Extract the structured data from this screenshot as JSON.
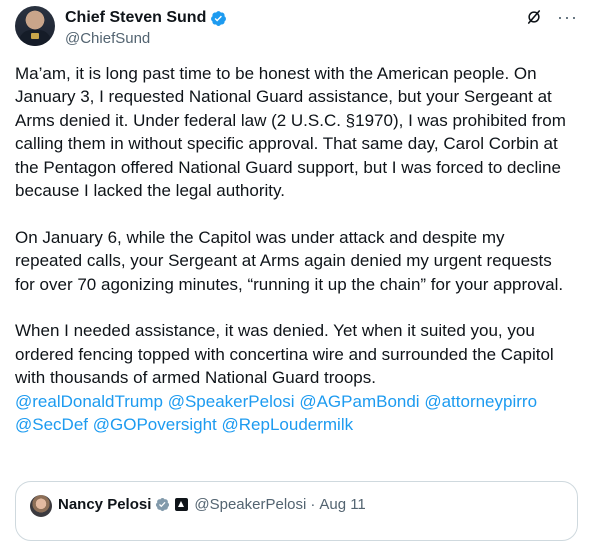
{
  "author": {
    "display_name": "Chief Steven Sund",
    "handle": "@ChiefSund"
  },
  "post": {
    "paragraphs": [
      "Ma’am, it is long past time to be honest with the American people. On January 3, I requested National Guard assistance, but your Sergeant at Arms denied it. Under federal law (2 U.S.C. §1970), I was prohibited from calling them in without specific approval. That same day, Carol Corbin at the Pentagon offered National Guard support, but I was forced to decline because I lacked the legal authority.",
      "On January 6, while the Capitol was under attack and despite my repeated calls, your Sergeant at Arms again denied my urgent requests for over 70 agonizing minutes, “running it up the chain” for your approval.",
      "When I needed assistance, it was denied. Yet when it suited you, you ordered fencing topped with concertina wire and surrounded the Capitol with thousands of armed National Guard troops."
    ],
    "mentions": [
      "@realDonaldTrump",
      "@SpeakerPelosi",
      "@AGPamBondi",
      "@attorneypirro",
      "@SecDef",
      "@GOPoversight",
      "@RepLoudermilk"
    ]
  },
  "quoted": {
    "display_name": "Nancy Pelosi",
    "handle": "@SpeakerPelosi",
    "separator": "·",
    "time": "Aug 11"
  },
  "icons": {
    "verified": "verified-badge-icon",
    "grok": "grok-icon",
    "more": "more-icon",
    "affiliation": "government-affiliation-icon"
  },
  "colors": {
    "accent": "#1d9bf0",
    "text": "#0f1419",
    "secondary": "#536471",
    "border": "#cfd9de"
  }
}
